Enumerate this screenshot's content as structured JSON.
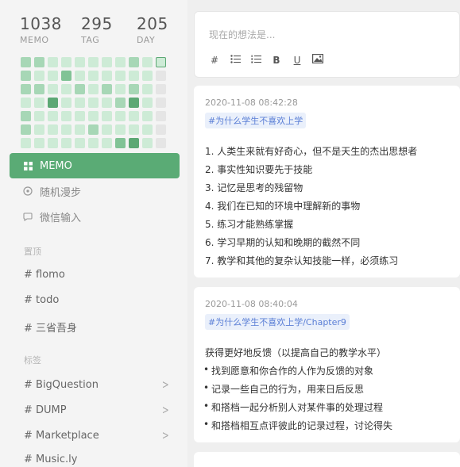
{
  "stats": [
    {
      "value": "1038",
      "label": "MEMO"
    },
    {
      "value": "295",
      "label": "TAG"
    },
    {
      "value": "205",
      "label": "DAY"
    }
  ],
  "heatmap": {
    "columns": 11,
    "levels": [
      2,
      2,
      1,
      1,
      1,
      1,
      1,
      1,
      2,
      1,
      1,
      2,
      1,
      1,
      3,
      1,
      1,
      1,
      1,
      1,
      1,
      0,
      2,
      2,
      1,
      1,
      2,
      1,
      2,
      1,
      2,
      1,
      0,
      1,
      1,
      4,
      1,
      1,
      1,
      1,
      2,
      4,
      1,
      0,
      2,
      1,
      1,
      1,
      1,
      1,
      1,
      1,
      1,
      1,
      0,
      2,
      1,
      1,
      1,
      1,
      2,
      1,
      1,
      1,
      1,
      0,
      1,
      1,
      1,
      1,
      1,
      1,
      1,
      3,
      4,
      1,
      0
    ],
    "colors": {
      "0": "#e5e5e5",
      "1": "#cdebd6",
      "2": "#a7d7b6",
      "3": "#81c396",
      "4": "#5ca874"
    }
  },
  "nav": [
    {
      "label": "MEMO",
      "icon": "grid-icon",
      "active": true
    },
    {
      "label": "随机漫步",
      "icon": "shuffle-icon",
      "active": false
    },
    {
      "label": "微信输入",
      "icon": "chat-icon",
      "active": false
    }
  ],
  "pinned": {
    "title": "置顶",
    "items": [
      "# flomo",
      "# todo",
      "# 三省吾身"
    ]
  },
  "tags": {
    "title": "标签",
    "items": [
      {
        "label": "# BigQuestion",
        "has_children": true
      },
      {
        "label": "# DUMP",
        "has_children": true
      },
      {
        "label": "# Marketplace",
        "has_children": true
      },
      {
        "label": "# Music.ly",
        "has_children": false
      }
    ]
  },
  "editor": {
    "placeholder": "现在的想法是...",
    "tools": [
      "#",
      "bulleted-list-icon",
      "numbered-list-icon",
      "B",
      "U",
      "image-icon"
    ]
  },
  "memos": [
    {
      "timestamp": "2020-11-08 08:42:28",
      "topic": "#为什么学生不喜欢上学",
      "lines": [
        "1. 人类生来就有好奇心，但不是天生的杰出思想者",
        "2. 事实性知识要先于技能",
        "3. 记忆是思考的残留物",
        "4. 我们在已知的环境中理解新的事物",
        "5. 练习才能熟练掌握",
        "6. 学习早期的认知和晚期的截然不同",
        "7. 教学和其他的复杂认知技能一样，必须练习"
      ]
    },
    {
      "timestamp": "2020-11-08 08:40:04",
      "topic": "#为什么学生不喜欢上学/Chapter9",
      "heading": "获得更好地反馈（以提高自己的教学水平）",
      "bullets": [
        "找到愿意和你合作的人作为反馈的对象",
        "记录一些自己的行为，用来日后反思",
        "和搭档一起分析别人对某件事的处理过程",
        "和搭档相互点评彼此的记录过程，讨论得失"
      ]
    }
  ]
}
